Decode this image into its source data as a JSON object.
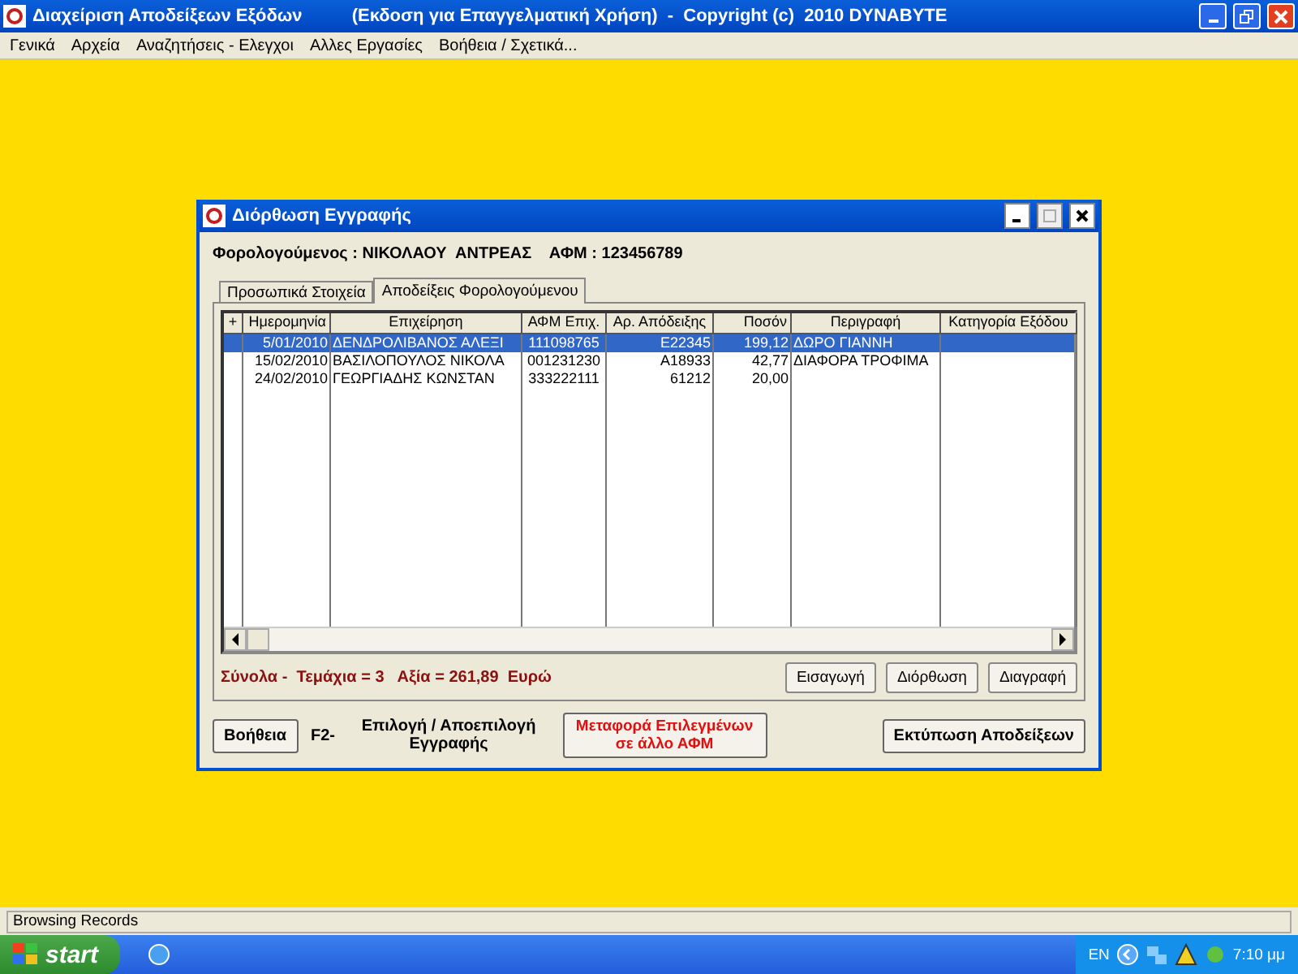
{
  "window": {
    "title": "Διαχείριση Αποδείξεων Εξόδων          (Εκδοση για Επαγγελματική Χρήση)  -  Copyright (c)  2010 DYNABYTE"
  },
  "menu": [
    "Γενικά",
    "Αρχεία",
    "Αναζητήσεις - Ελεγχοι",
    "Αλλες Εργασίες",
    "Βοήθεια / Σχετικά..."
  ],
  "dialog": {
    "title": "Διόρθωση Εγγραφής",
    "taxpayer": "Φορολογούμενος : ΝΙΚΟΛΑΟΥ  ΑΝΤΡΕΑΣ    ΑΦΜ : 123456789",
    "tabs": [
      {
        "label": "Προσωπικά Στοιχεία",
        "selected": false
      },
      {
        "label": "Αποδείξεις Φορολογούμενου",
        "selected": true
      }
    ],
    "table": {
      "columns": [
        "+",
        "Ημερομηνία",
        "Επιχείρηση",
        "ΑΦΜ Επιχ.",
        "Αρ. Απόδειξης",
        "Ποσόν",
        "Περιγραφή",
        "Κατηγορία Εξόδου"
      ],
      "rows": [
        {
          "selected": true,
          "cells": [
            "",
            "5/01/2010",
            "ΔΕΝΔΡΟΛΙΒΑΝΟΣ ΑΛΕΞΙ",
            "111098765",
            "Ε22345",
            "199,12",
            "ΔΩΡΟ ΓΙΑΝΝΗ",
            ""
          ]
        },
        {
          "selected": false,
          "cells": [
            "",
            "15/02/2010",
            "ΒΑΣΙΛΟΠΟΥΛΟΣ ΝΙΚΟΛΑ",
            "001231230",
            "Α18933",
            "42,77",
            "ΔΙΑΦΟΡΑ ΤΡΟΦΙΜΑ",
            ""
          ]
        },
        {
          "selected": false,
          "cells": [
            "",
            "24/02/2010",
            "ΓΕΩΡΓΙΑΔΗΣ ΚΩΝΣΤΑΝ",
            "333222111",
            "61212",
            "20,00",
            "",
            ""
          ]
        }
      ]
    },
    "totals": "Σύνολα -  Τεμάχια = 3   Αξία = 261,89  Ευρώ",
    "grid_buttons": [
      "Εισαγωγή",
      "Διόρθωση",
      "Διαγραφή"
    ],
    "help_button": "Βοήθεια",
    "shortcut_key": "F2-",
    "shortcut_label": "Επιλογή / Αποεπιλογή Εγγραφής",
    "transfer_button": "Μεταφορά Επιλεγμένων σε άλλο ΑΦΜ",
    "print_button": "Εκτύπωση Αποδείξεων"
  },
  "status_bar": "Browsing Records",
  "taskbar": {
    "start": "start",
    "language": "EN",
    "clock": "7:10 μμ"
  }
}
